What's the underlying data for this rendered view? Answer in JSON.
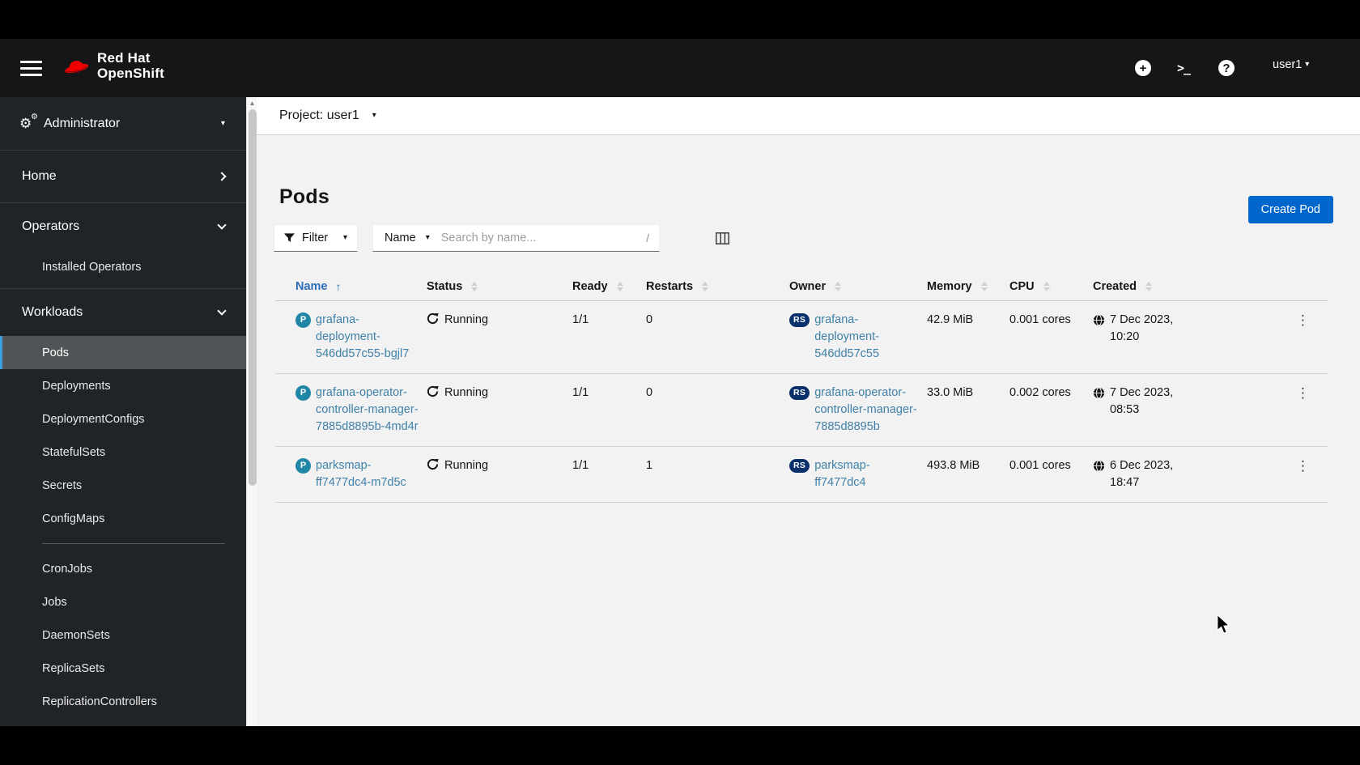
{
  "masthead": {
    "brand": {
      "line1": "Red Hat",
      "line2": "OpenShift"
    },
    "user": {
      "name": "user1"
    },
    "icons": {
      "plus": "+",
      "terminal": ">_",
      "help": "?"
    }
  },
  "sidebar": {
    "perspective": {
      "label": "Administrator"
    },
    "nav": [
      {
        "label": "Home",
        "expanded": false,
        "items": []
      },
      {
        "label": "Operators",
        "expanded": true,
        "items": [
          {
            "label": "Installed Operators"
          }
        ]
      },
      {
        "label": "Workloads",
        "expanded": true,
        "items": [
          {
            "label": "Pods",
            "active": true
          },
          {
            "label": "Deployments"
          },
          {
            "label": "DeploymentConfigs"
          },
          {
            "label": "StatefulSets"
          },
          {
            "label": "Secrets"
          },
          {
            "label": "ConfigMaps"
          },
          {
            "divider": true
          },
          {
            "label": "CronJobs"
          },
          {
            "label": "Jobs"
          },
          {
            "label": "DaemonSets"
          },
          {
            "label": "ReplicaSets"
          },
          {
            "label": "ReplicationControllers"
          }
        ]
      }
    ]
  },
  "content": {
    "project_bar": {
      "label": "Project: user1"
    },
    "page": {
      "title": "Pods",
      "create_button": "Create Pod"
    },
    "toolbar": {
      "filter_label": "Filter",
      "attribute_label": "Name",
      "search_placeholder": "Search by name...",
      "search_shortcut": "/"
    },
    "table": {
      "columns": [
        "Name",
        "Status",
        "Ready",
        "Restarts",
        "Owner",
        "Memory",
        "CPU",
        "Created"
      ],
      "sort": {
        "column": "Name",
        "direction": "asc"
      },
      "rows": [
        {
          "badge": "P",
          "name": "grafana-deployment-546dd57c55-bgjl7",
          "status": "Running",
          "ready": "1/1",
          "restarts": "0",
          "owner_badge": "RS",
          "owner": "grafana-deployment-546dd57c55",
          "memory": "42.9 MiB",
          "cpu": "0.001 cores",
          "created": "7 Dec 2023, 10:20"
        },
        {
          "badge": "P",
          "name": "grafana-operator-controller-manager-7885d8895b-4md4r",
          "status": "Running",
          "ready": "1/1",
          "restarts": "0",
          "owner_badge": "RS",
          "owner": "grafana-operator-controller-manager-7885d8895b",
          "memory": "33.0 MiB",
          "cpu": "0.002 cores",
          "created": "7 Dec 2023, 08:53"
        },
        {
          "badge": "P",
          "name": "parksmap-ff7477dc4-m7d5c",
          "status": "Running",
          "ready": "1/1",
          "restarts": "1",
          "owner_badge": "RS",
          "owner": "parksmap-ff7477dc4",
          "memory": "493.8 MiB",
          "cpu": "0.001 cores",
          "created": "6 Dec 2023, 18:47"
        }
      ]
    }
  },
  "colors": {
    "accent": "#0066cc",
    "link": "#3f81a8",
    "pod_badge": "#2186a5",
    "owner_badge": "#08306b",
    "masthead_bg": "#161618",
    "sidebar_bg": "#212427",
    "sidebar_active_border": "#3a9fdc",
    "content_bg": "#f2f2f2",
    "brand_red": "#ee0000"
  }
}
